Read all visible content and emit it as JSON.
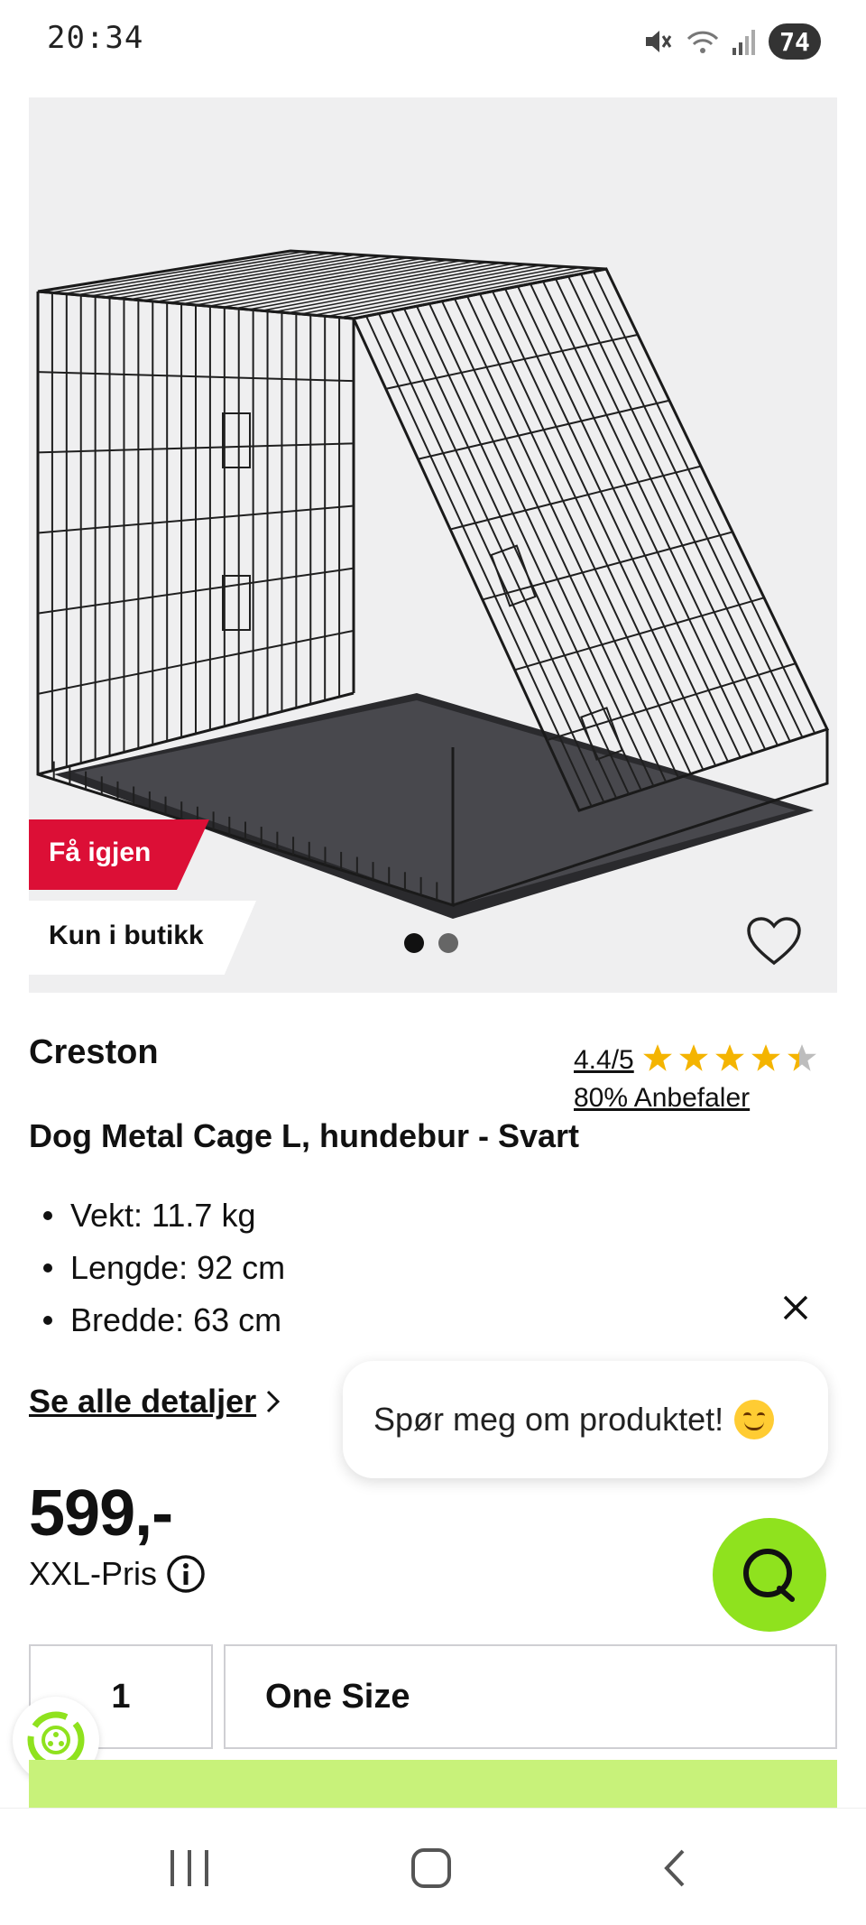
{
  "status_bar": {
    "time": "20:34",
    "battery": "74"
  },
  "gallery": {
    "badge_return": "Få igjen",
    "badge_store": "Kun i butikk",
    "dots_count": 2,
    "active_dot": 1
  },
  "product": {
    "brand": "Creston",
    "rating": "4.4/5",
    "rating_value": 4.4,
    "rating_max": 5,
    "recommend": "80% Anbefaler",
    "title": "Dog Metal Cage L, hundebur - Svart",
    "specs": [
      "Vekt: 11.7 kg",
      "Lengde: 92 cm",
      "Bredde: 63 cm"
    ],
    "details_link": "Se alle detaljer",
    "price": "599,-",
    "price_label": "XXL-Pris"
  },
  "chat": {
    "prompt": "Spør meg om produktet!"
  },
  "purchase": {
    "quantity": "1",
    "size": "One Size"
  },
  "colors": {
    "accent_red": "#dc0f36",
    "accent_green": "#8fe21e",
    "cta_green": "#c8f27a",
    "star": "#f4b400"
  }
}
